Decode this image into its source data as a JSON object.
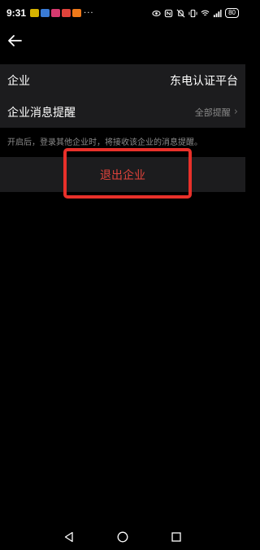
{
  "status_bar": {
    "time": "9:31",
    "more": "···",
    "battery": "80",
    "app_icons": [
      "#d6b300",
      "#3a7bd5",
      "#d63a6f",
      "#e0433b",
      "#f07a1a"
    ]
  },
  "header": {
    "back_icon": "arrow-left-icon"
  },
  "settings": {
    "company_label": "企业",
    "company_value": "东电认证平台",
    "notify_label": "企业消息提醒",
    "notify_value": "全部提醒",
    "chevron": "›"
  },
  "hint": "开启后，登录其他企业时，将接收该企业的消息提醒。",
  "exit_label": "退出企业",
  "colors": {
    "accent_red": "#e0433b",
    "highlight": "#e8302a",
    "row_bg": "#1c1c1e"
  }
}
